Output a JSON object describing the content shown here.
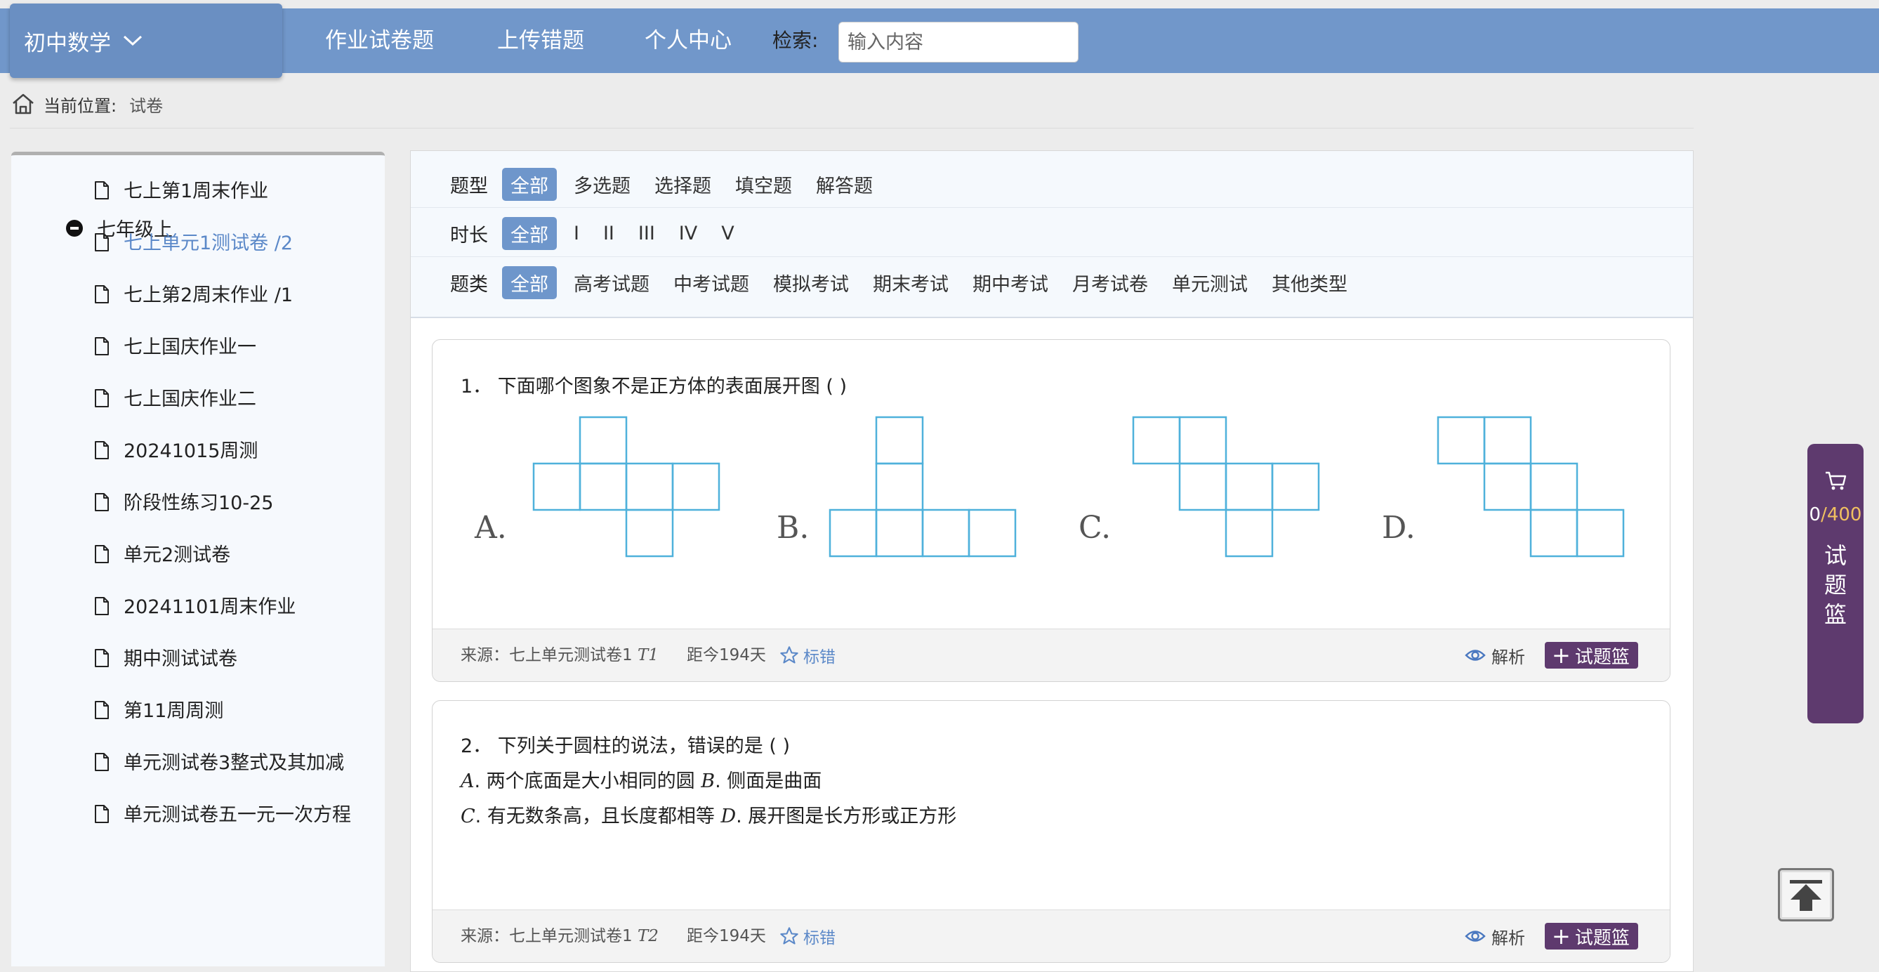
{
  "header": {
    "subject": "初中数学",
    "nav": [
      "作业试卷题",
      "上传错题",
      "个人中心"
    ],
    "search_label": "检索:",
    "search_placeholder": "输入内容"
  },
  "breadcrumb": {
    "label": "当前位置:",
    "current": "试卷"
  },
  "sidebar": {
    "root": "七年级上",
    "items": [
      "七上第1周末作业",
      "七上单元1测试卷 /2",
      "七上第2周末作业 /1",
      "七上国庆作业一",
      "七上国庆作业二",
      "20241015周测",
      "阶段性练习10-25",
      "单元2测试卷",
      "20241101周末作业",
      "期中测试试卷",
      "第11周周测",
      "单元测试卷3整式及其加减",
      "单元测试卷五一元一次方程"
    ],
    "active_index": 1
  },
  "filters": {
    "type": {
      "label": "题型",
      "options": [
        "全部",
        "多选题",
        "选择题",
        "填空题",
        "解答题"
      ]
    },
    "duration": {
      "label": "时长",
      "options": [
        "全部",
        "I",
        "II",
        "III",
        "IV",
        "V"
      ]
    },
    "category": {
      "label": "题类",
      "options": [
        "全部",
        "高考试题",
        "中考试题",
        "模拟考试",
        "期末考试",
        "期中考试",
        "月考试卷",
        "单元测试",
        "其他类型"
      ]
    }
  },
  "questions": [
    {
      "stem": "1．   下面哪个图象不是正方体的表面展开图 (    )",
      "option_letters": [
        "A.",
        "B.",
        "C.",
        "D."
      ],
      "source_prefix": "来源：七上单元测试卷1",
      "source_tag": "T1",
      "days": "距今194天",
      "mark_error": "标错",
      "analysis": "解析",
      "add": "试题篮"
    },
    {
      "stem": "2．   下列关于圆柱的说法，错误的是 (    )",
      "line_a_letter": "A",
      "line_a_text": ". 两个底面是大小相同的圆",
      "line_b_letter": "B",
      "line_b_text": ". 侧面是曲面",
      "line_c_letter": "C",
      "line_c_text": ". 有无数条高，且长度都相等",
      "line_d_letter": "D",
      "line_d_text": ". 展开图是长方形或正方形",
      "source_prefix": "来源：七上单元测试卷1",
      "source_tag": "T2",
      "days": "距今194天",
      "mark_error": "标错",
      "analysis": "解析",
      "add": "试题篮"
    }
  ],
  "cart": {
    "count": "0",
    "max": "/400",
    "label": "试题篮"
  }
}
